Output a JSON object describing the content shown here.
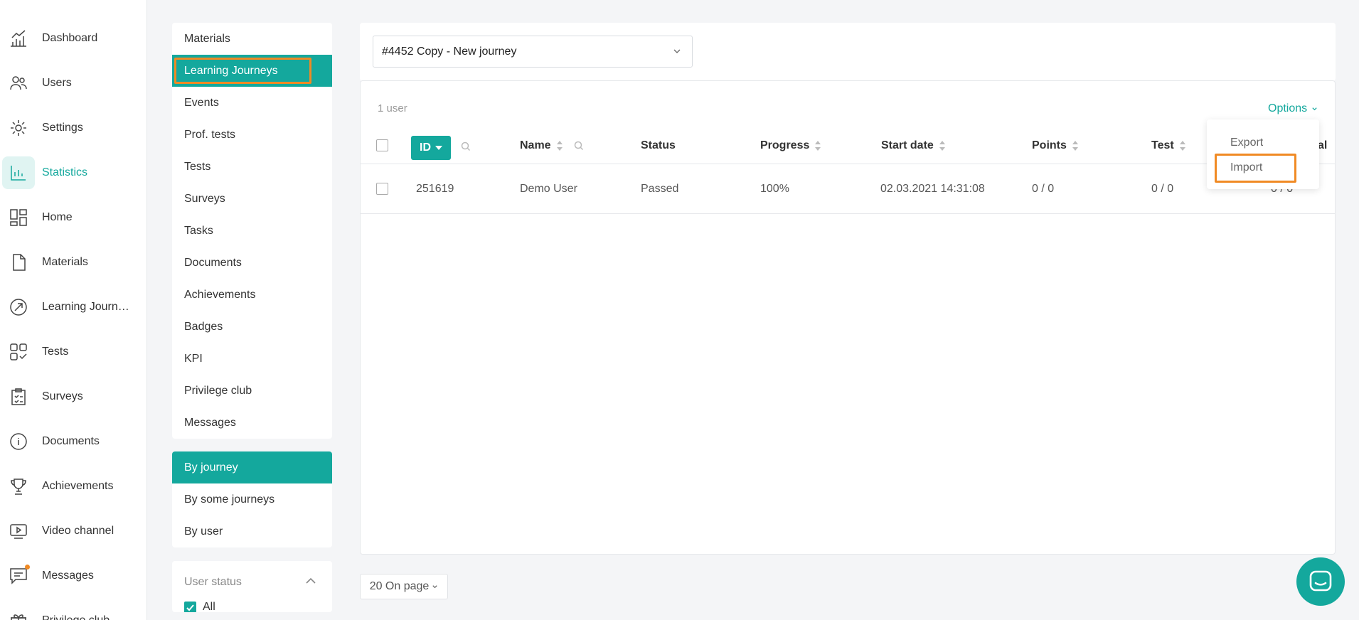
{
  "nav": {
    "items": [
      {
        "label": "Dashboard",
        "icon": "chart-up-icon"
      },
      {
        "label": "Users",
        "icon": "users-icon"
      },
      {
        "label": "Settings",
        "icon": "gear-icon"
      },
      {
        "label": "Statistics",
        "icon": "bar-chart-icon",
        "active": true
      },
      {
        "label": "Home",
        "icon": "layout-icon"
      },
      {
        "label": "Materials",
        "icon": "document-icon"
      },
      {
        "label": "Learning Journ…",
        "icon": "journey-icon"
      },
      {
        "label": "Tests",
        "icon": "tests-icon"
      },
      {
        "label": "Surveys",
        "icon": "clipboard-icon"
      },
      {
        "label": "Documents",
        "icon": "info-icon"
      },
      {
        "label": "Achievements",
        "icon": "trophy-icon"
      },
      {
        "label": "Video channel",
        "icon": "video-icon"
      },
      {
        "label": "Messages",
        "icon": "message-icon",
        "notification": true
      },
      {
        "label": "Privilege club",
        "icon": "gift-icon"
      }
    ]
  },
  "submenu": {
    "items": [
      "Materials",
      "Learning Journeys",
      "Events",
      "Prof. tests",
      "Tests",
      "Surveys",
      "Tasks",
      "Documents",
      "Achievements",
      "Badges",
      "KPI",
      "Privilege club",
      "Messages"
    ],
    "active_index": 1
  },
  "mode_menu": {
    "items": [
      "By journey",
      "By some journeys",
      "By user"
    ],
    "active_index": 0
  },
  "filter": {
    "title": "User status",
    "all_label": "All"
  },
  "journey_select": {
    "value": "#4452 Copy - New journey"
  },
  "table": {
    "count_label": "1 user",
    "options_label": "Options",
    "columns": {
      "id": "ID",
      "name": "Name",
      "status": "Status",
      "progress": "Progress",
      "start_date": "Start date",
      "points": "Points",
      "test": "Test",
      "total_partial": "al"
    },
    "rows": [
      {
        "id": "251619",
        "name": "Demo User",
        "status": "Passed",
        "progress": "100%",
        "start_date": "02.03.2021 14:31:08",
        "points": "0 / 0",
        "test": "0 / 0",
        "total_partial": "0 / 0"
      }
    ]
  },
  "options_menu": {
    "export_label": "Export",
    "import_label": "Import"
  },
  "pager": {
    "label": "20 On page"
  },
  "colors": {
    "accent": "#14a89d",
    "highlight": "#f08a24"
  }
}
